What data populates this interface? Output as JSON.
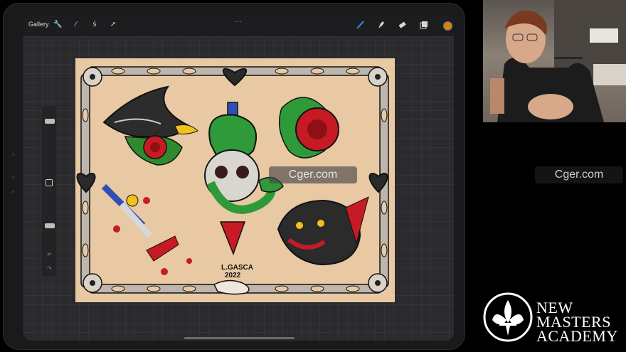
{
  "app": {
    "gallery_label": "Gallery",
    "tools_left": [
      "wrench-icon",
      "magic-wand-icon",
      "selection-s-icon",
      "arrow-transform-icon"
    ],
    "tools_right": [
      "brush-icon",
      "smudge-icon",
      "eraser-icon",
      "layers-icon"
    ],
    "active_color": "#d1821c",
    "more_label": "..."
  },
  "artwork": {
    "signature_line1": "L.GASCA",
    "signature_line2": "2022",
    "background_color": "#e8c9a3"
  },
  "watermark": {
    "text_canvas": "Cger.com",
    "text_side": "Cger.com"
  },
  "brand": {
    "line1": "NEW",
    "line2": "MASTERS",
    "line3": "ACADEMY"
  }
}
